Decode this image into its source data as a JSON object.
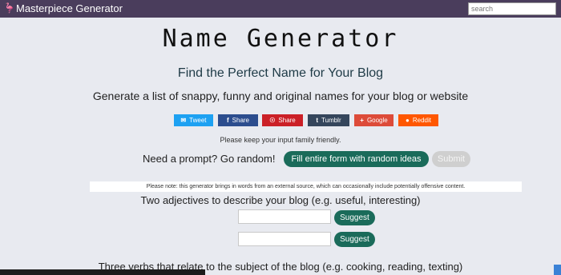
{
  "header": {
    "brand": "Masterpiece Generator",
    "logo_icon": "flamingo-icon",
    "search_placeholder": "search",
    "bg_color": "#4a3d5c"
  },
  "main": {
    "title": "Name Generator",
    "subtitle": "Find the Perfect Name for Your Blog",
    "description": "Generate a list of snappy, funny and original names for your blog or website",
    "share_buttons": [
      {
        "label": "Tweet",
        "icon": "twitter-icon",
        "glyph": "✉",
        "color": "#1da1f2"
      },
      {
        "label": "Share",
        "icon": "facebook-icon",
        "glyph": "f",
        "color": "#2c4d8e"
      },
      {
        "label": "Share",
        "icon": "pinterest-icon",
        "glyph": "☉",
        "color": "#cb2027"
      },
      {
        "label": "Tumblr",
        "icon": "tumblr-icon",
        "glyph": "t",
        "color": "#35465c"
      },
      {
        "label": "Google",
        "icon": "google-plus-icon",
        "glyph": "+",
        "color": "#dd4b39"
      },
      {
        "label": "Reddit",
        "icon": "reddit-icon",
        "glyph": "●",
        "color": "#ff5700"
      }
    ],
    "family_note": "Please keep your input family friendly.",
    "prompt_label": "Need a prompt? Go random!",
    "fill_button": "Fill entire form with random ideas",
    "submit_button": "Submit",
    "external_note": "Please note: this generator brings in words from an external source, which can occasionally include potentially offensive content.",
    "question_1": "Two adjectives to describe your blog (e.g. useful, interesting)",
    "suggest_label": "Suggest",
    "question_2": "Three verbs that relate to the subject of the blog (e.g. cooking, reading, texting)",
    "accent_color": "#1a6b5a"
  }
}
